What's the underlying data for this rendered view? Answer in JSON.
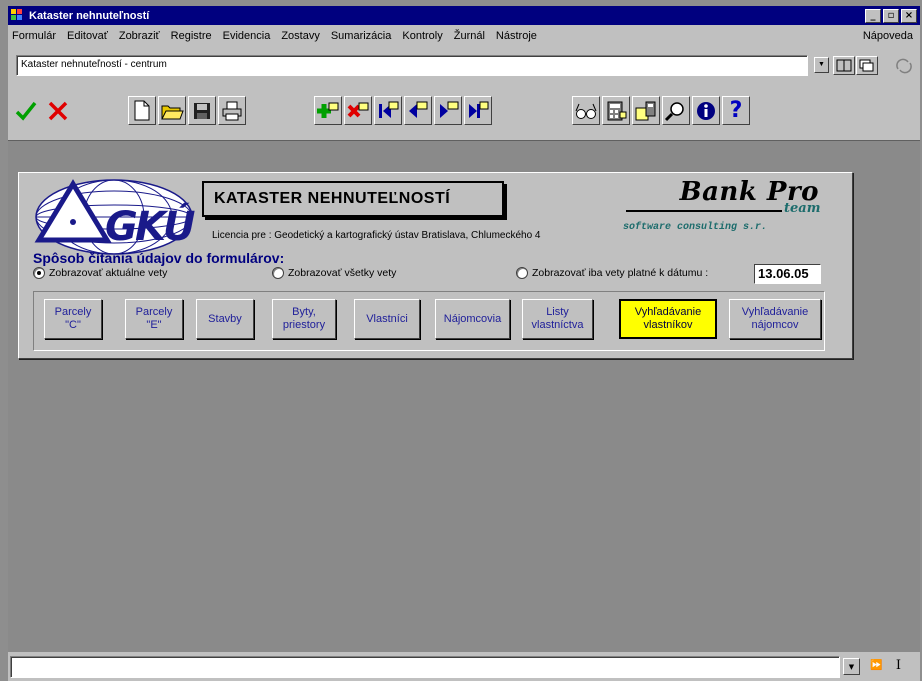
{
  "window": {
    "title": "Kataster nehnuteľností",
    "min_glyph": "_",
    "max_glyph": "▫",
    "close_glyph": "×"
  },
  "menu": {
    "items": [
      "Formulár",
      "Editovať",
      "Zobraziť",
      "Registre",
      "Evidencia",
      "Zostavy",
      "Sumarizácia",
      "Kontroly",
      "Žurnál",
      "Nástroje"
    ],
    "help": "Nápoveda"
  },
  "address": {
    "value": "Kataster nehnuteľností - centrum"
  },
  "toolbar": {
    "icons": [
      "confirm-check-icon",
      "cancel-x-icon",
      "new-document-icon",
      "open-folder-icon",
      "save-disk-icon",
      "print-icon",
      "add-record-icon",
      "delete-record-icon",
      "first-record-icon",
      "previous-record-icon",
      "next-record-icon",
      "last-record-icon",
      "view-glasses-icon",
      "calculator-icon",
      "edit-note-icon",
      "search-magnifier-icon",
      "info-icon",
      "help-question-icon"
    ],
    "colors": {
      "check": "#00a000",
      "x": "#e00000",
      "record_plus": "#00a000",
      "info": "#00007f",
      "help": "#0000c0"
    }
  },
  "form": {
    "heading": "KATASTER NEHNUTEĽNOSTÍ",
    "license": "Licencia pre : Geodetický a kartografický ústav Bratislava, Chlumeckého 4",
    "brand": "Bank Pro",
    "brand_team": "team",
    "brand_sub": "software consulting s.r.",
    "logo_text": "GKÚ",
    "mode_label": "Spôsob čítania údajov do formulárov:",
    "radios": [
      {
        "label": "Zobrazovať aktuálne vety",
        "selected": true
      },
      {
        "label": "Zobrazovať všetky vety",
        "selected": false
      },
      {
        "label": "Zobrazovať iba vety platné k dátumu :",
        "selected": false
      }
    ],
    "date": "13.06.05",
    "buttons": [
      {
        "label": "Parcely\n\"C\""
      },
      {
        "label": "Parcely\n\"E\""
      },
      {
        "label": "Stavby"
      },
      {
        "label": "Byty,\npriestory"
      },
      {
        "label": "Vlastníci"
      },
      {
        "label": "Nájomcovia"
      },
      {
        "label": "Listy\nvlastníctva"
      },
      {
        "label": "Vyhľadávanie\nvlastníkov",
        "highlighted": true
      },
      {
        "label": "Vyhľadávanie\nnájomcov"
      }
    ]
  },
  "colors": {
    "titlebar": "#00007f",
    "client": "#8a8a8a",
    "face": "#c0c0c0",
    "highlight_button": "#ffff00"
  }
}
